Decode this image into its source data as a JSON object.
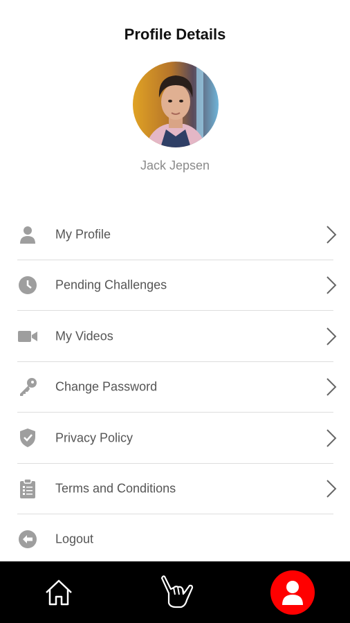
{
  "header": {
    "title": "Profile Details"
  },
  "profile": {
    "name": "Jack Jepsen",
    "avatar_icon": "user-photo"
  },
  "menu": {
    "items": [
      {
        "label": "My Profile",
        "icon": "person-icon",
        "has_chevron": true
      },
      {
        "label": "Pending Challenges",
        "icon": "clock-icon",
        "has_chevron": true
      },
      {
        "label": "My Videos",
        "icon": "video-camera-icon",
        "has_chevron": true
      },
      {
        "label": "Change Password",
        "icon": "key-icon",
        "has_chevron": true
      },
      {
        "label": "Privacy Policy",
        "icon": "shield-icon",
        "has_chevron": true
      },
      {
        "label": "Terms and Conditions",
        "icon": "clipboard-icon",
        "has_chevron": true
      },
      {
        "label": "Logout",
        "icon": "logout-icon",
        "has_chevron": false
      }
    ]
  },
  "bottom_nav": {
    "items": [
      {
        "icon": "home-icon",
        "active": false
      },
      {
        "icon": "shaka-hand-icon",
        "active": false
      },
      {
        "icon": "profile-icon",
        "active": true
      }
    ]
  },
  "colors": {
    "accent": "#ff0000",
    "nav_background": "#000000",
    "icon_gray": "#9e9e9e",
    "label_gray": "#555555",
    "name_gray": "#8a8a8a"
  }
}
